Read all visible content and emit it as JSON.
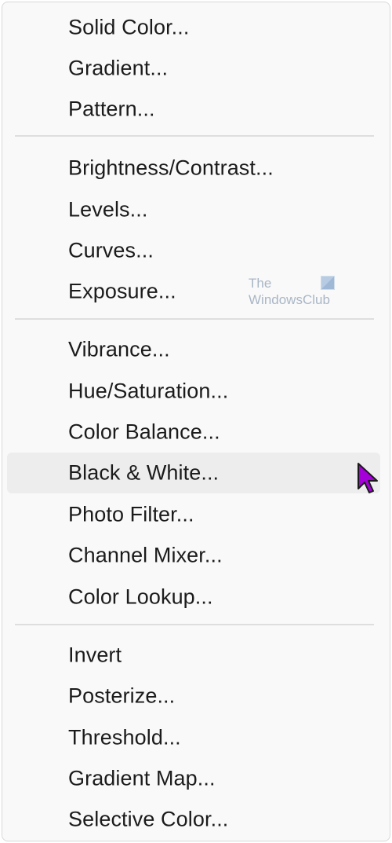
{
  "menu": {
    "groups": [
      {
        "items": [
          {
            "label": "Solid Color..."
          },
          {
            "label": "Gradient..."
          },
          {
            "label": "Pattern..."
          }
        ]
      },
      {
        "items": [
          {
            "label": "Brightness/Contrast..."
          },
          {
            "label": "Levels..."
          },
          {
            "label": "Curves..."
          },
          {
            "label": "Exposure..."
          }
        ]
      },
      {
        "items": [
          {
            "label": "Vibrance..."
          },
          {
            "label": "Hue/Saturation..."
          },
          {
            "label": "Color Balance..."
          },
          {
            "label": "Black & White...",
            "highlighted": true
          },
          {
            "label": "Photo Filter..."
          },
          {
            "label": "Channel Mixer..."
          },
          {
            "label": "Color Lookup..."
          }
        ]
      },
      {
        "items": [
          {
            "label": "Invert"
          },
          {
            "label": "Posterize..."
          },
          {
            "label": "Threshold..."
          },
          {
            "label": "Gradient Map..."
          },
          {
            "label": "Selective Color..."
          }
        ]
      }
    ]
  },
  "watermark": {
    "line1": "The",
    "line2": "WindowsClub"
  },
  "colors": {
    "menu_background": "#f9f9f9",
    "highlight": "#ededed",
    "text": "#1b1b1b",
    "separator": "#dedede",
    "cursor": "#a400d8"
  }
}
